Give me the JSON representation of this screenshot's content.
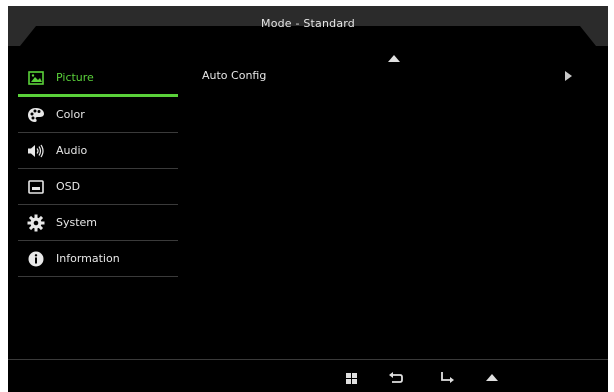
{
  "header": {
    "title": "Mode - Standard"
  },
  "sidebar": {
    "items": [
      {
        "label": "Picture",
        "icon": "picture-icon",
        "active": true
      },
      {
        "label": "Color",
        "icon": "palette-icon",
        "active": false
      },
      {
        "label": "Audio",
        "icon": "speaker-icon",
        "active": false
      },
      {
        "label": "OSD",
        "icon": "osd-icon",
        "active": false
      },
      {
        "label": "System",
        "icon": "gear-icon",
        "active": false
      },
      {
        "label": "Information",
        "icon": "info-icon",
        "active": false
      }
    ]
  },
  "main": {
    "items": [
      {
        "label": "Auto Config",
        "icon": "chevron-right-icon"
      }
    ]
  },
  "bottom_bar": {
    "buttons": [
      "menu-grid-icon",
      "back-icon",
      "enter-icon",
      "up-icon"
    ]
  },
  "colors": {
    "accent": "#5ad13a",
    "background": "#000000",
    "text": "#e8e8e8",
    "header": "#2b2b2b"
  }
}
